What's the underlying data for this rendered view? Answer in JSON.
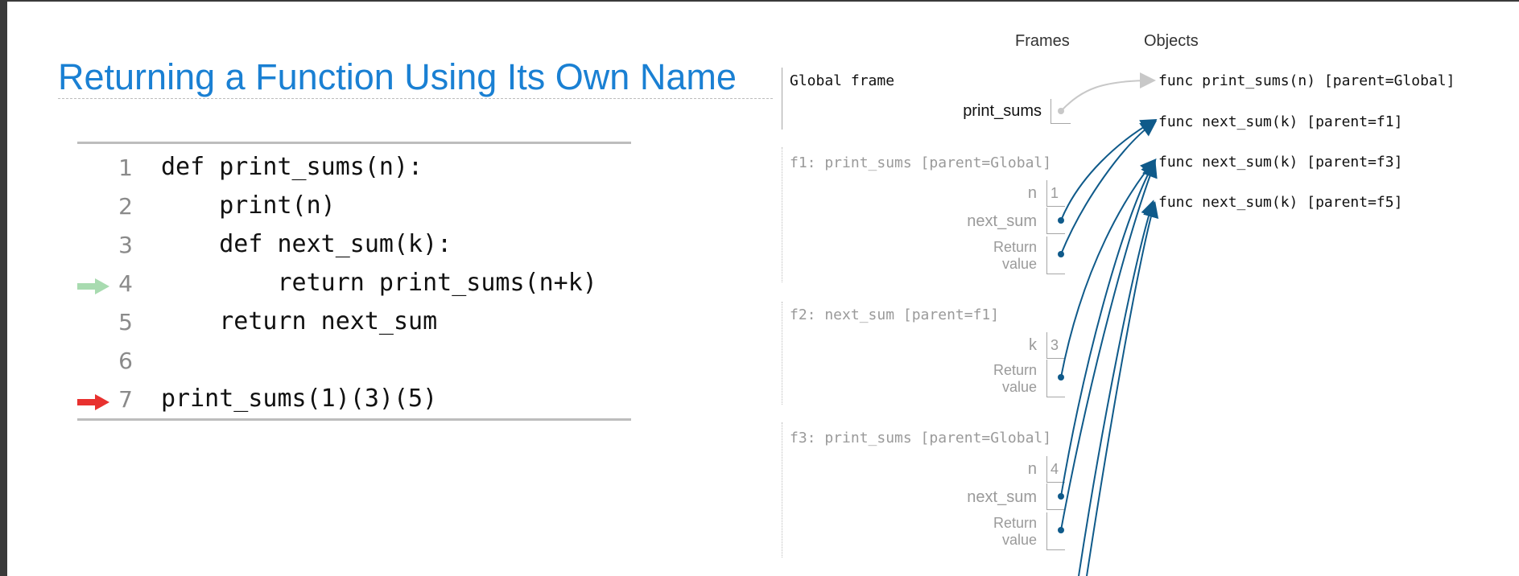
{
  "slide": {
    "title": "Returning a Function Using Its Own Name"
  },
  "code": {
    "lines": [
      {
        "num": "1",
        "text": "def print_sums(n):"
      },
      {
        "num": "2",
        "text": "    print(n)"
      },
      {
        "num": "3",
        "text": "    def next_sum(k):"
      },
      {
        "num": "4",
        "text": "        return print_sums(n+k)"
      },
      {
        "num": "5",
        "text": "    return next_sum"
      },
      {
        "num": "6",
        "text": ""
      },
      {
        "num": "7",
        "text": "print_sums(1)(3)(5)"
      }
    ],
    "prev_line_arrow_color": "#a8dbb0",
    "next_line_arrow_color": "#e8312f"
  },
  "viz": {
    "frames_header": "Frames",
    "objects_header": "Objects",
    "global": {
      "name": "Global frame",
      "var": "print_sums"
    },
    "f1": {
      "name": "f1: print_sums [parent=Global]",
      "n_label": "n",
      "n_value": "1",
      "next_sum_label": "next_sum",
      "return_label_1": "Return",
      "return_label_2": "value"
    },
    "f2": {
      "name": "f2: next_sum [parent=f1]",
      "k_label": "k",
      "k_value": "3",
      "return_label_1": "Return",
      "return_label_2": "value"
    },
    "f3": {
      "name": "f3: print_sums [parent=Global]",
      "n_label": "n",
      "n_value": "4",
      "next_sum_label": "next_sum",
      "return_label_1": "Return",
      "return_label_2": "value"
    },
    "objects": [
      "func print_sums(n) [parent=Global]",
      "func next_sum(k) [parent=f1]",
      "func next_sum(k) [parent=f3]",
      "func next_sum(k) [parent=f5]"
    ],
    "pointer_color": "#0f5a8a",
    "global_pointer_color": "#c8c8c8"
  }
}
